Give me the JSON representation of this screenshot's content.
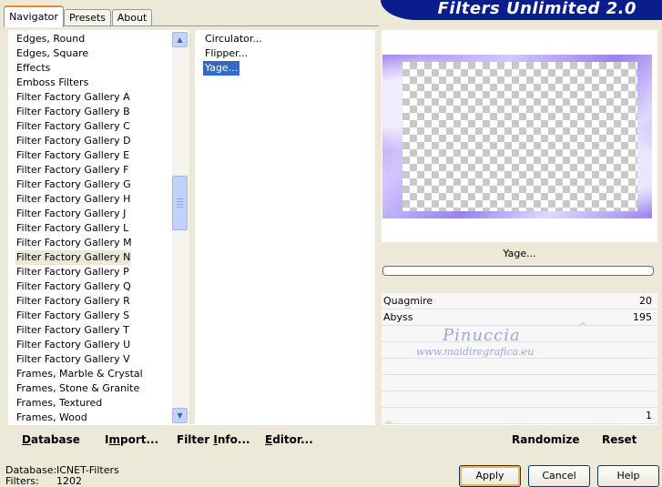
{
  "tabs": [
    "Navigator",
    "Presets",
    "About"
  ],
  "title": "Filters Unlimited 2.0",
  "categories": [
    "Edges, Round",
    "Edges, Square",
    "Effects",
    "Emboss Filters",
    "Filter Factory Gallery A",
    "Filter Factory Gallery B",
    "Filter Factory Gallery C",
    "Filter Factory Gallery D",
    "Filter Factory Gallery E",
    "Filter Factory Gallery F",
    "Filter Factory Gallery G",
    "Filter Factory Gallery H",
    "Filter Factory Gallery J",
    "Filter Factory Gallery L",
    "Filter Factory Gallery M",
    "Filter Factory Gallery N",
    "Filter Factory Gallery P",
    "Filter Factory Gallery Q",
    "Filter Factory Gallery R",
    "Filter Factory Gallery S",
    "Filter Factory Gallery T",
    "Filter Factory Gallery U",
    "Filter Factory Gallery V",
    "Frames, Marble & Crystal",
    "Frames, Stone & Granite",
    "Frames, Textured",
    "Frames, Wood"
  ],
  "selected_category": "Filter Factory Gallery N",
  "filters": [
    "Circulator...",
    "Flipper...",
    "Yage..."
  ],
  "selected_filter": "Yage...",
  "filter_name": "Yage...",
  "sliders": [
    {
      "label": "Quagmire",
      "value": "20"
    },
    {
      "label": "Abyss",
      "value": "195"
    },
    {
      "label": "",
      "value": ""
    },
    {
      "label": "",
      "value": ""
    },
    {
      "label": "",
      "value": ""
    },
    {
      "label": "",
      "value": ""
    },
    {
      "label": "",
      "value": ""
    },
    {
      "label": "",
      "value": "1"
    }
  ],
  "left_buttons": {
    "database": {
      "u": "D",
      "rest": "atabase"
    },
    "import": {
      "pre": "I",
      "u": "m",
      "rest": "port..."
    },
    "filter_info": {
      "pre": "Filter ",
      "u": "I",
      "rest": "nfo..."
    },
    "editor": {
      "u": "E",
      "rest": "ditor..."
    }
  },
  "right_buttons": {
    "randomize": "Randomize",
    "reset": "Reset"
  },
  "watermark": {
    "name": "Pinuccia",
    "url": "www.maidiregrafica.eu"
  },
  "status": {
    "database_label": "Database:",
    "database_value": "ICNET-Filters",
    "filters_label": "Filters:",
    "filters_value": "1202"
  },
  "dialog_buttons": {
    "apply": "Apply",
    "cancel": "Cancel",
    "help": "Help"
  },
  "colors": {
    "banner": "#0a1d8c",
    "selection": "#316ac5",
    "background": "#ece9d8"
  }
}
